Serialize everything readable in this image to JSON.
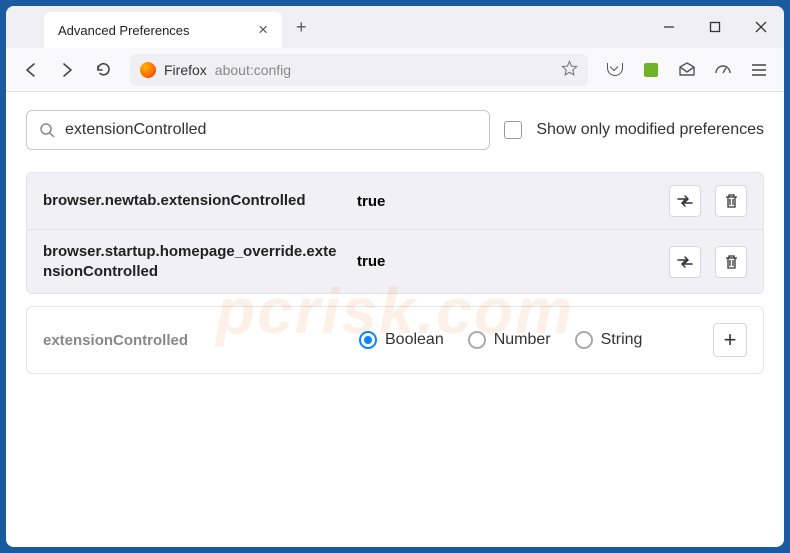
{
  "tab": {
    "title": "Advanced Preferences"
  },
  "url": {
    "identity": "Firefox",
    "path": "about:config"
  },
  "search": {
    "value": "extensionControlled",
    "checkbox_label": "Show only modified preferences"
  },
  "prefs": [
    {
      "name": "browser.newtab.extensionControlled",
      "value": "true"
    },
    {
      "name": "browser.startup.homepage_override.extensionControlled",
      "value": "true"
    }
  ],
  "add_row": {
    "name": "extensionControlled",
    "types": [
      "Boolean",
      "Number",
      "String"
    ],
    "selected": "Boolean"
  },
  "watermark": {
    "main": "pcrisk.com"
  }
}
